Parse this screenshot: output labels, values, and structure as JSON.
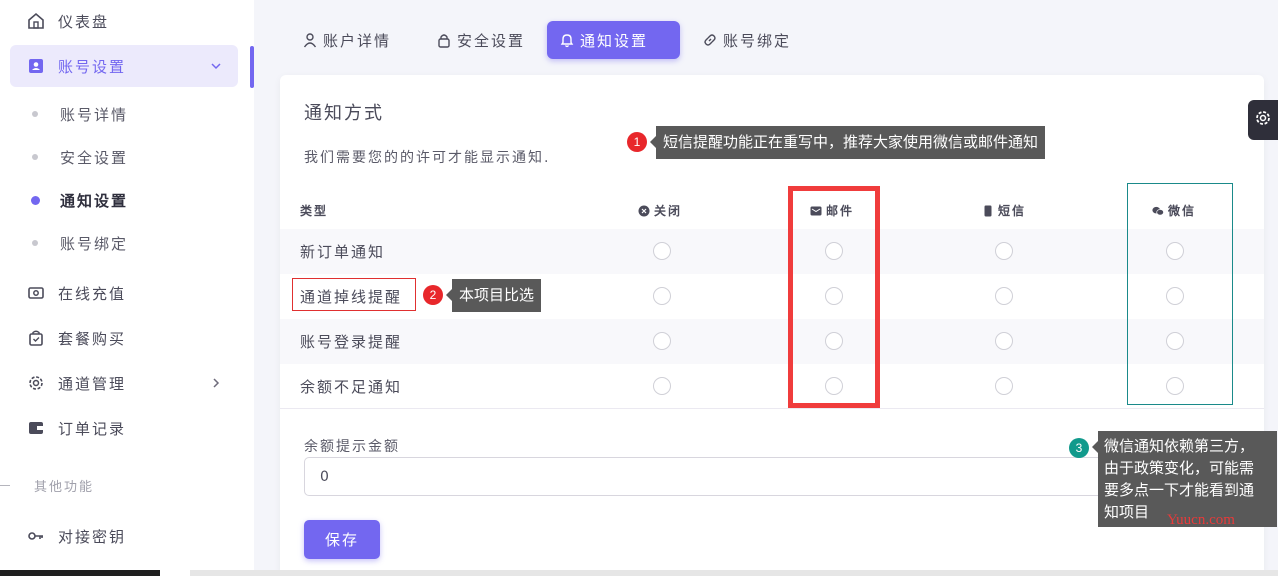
{
  "sidebar": {
    "dashboard": "仪表盘",
    "account_settings": "账号设置",
    "sub_items": [
      "账号详情",
      "安全设置",
      "通知设置",
      "账号绑定"
    ],
    "recharge": "在线充值",
    "package": "套餐购买",
    "channel": "通道管理",
    "orders": "订单记录",
    "section_other": "其他功能",
    "api_key": "对接密钥"
  },
  "tabs": [
    {
      "label": "账户详情",
      "icon": "user-icon"
    },
    {
      "label": "安全设置",
      "icon": "lock-icon"
    },
    {
      "label": "通知设置",
      "icon": "bell-icon"
    },
    {
      "label": "账号绑定",
      "icon": "link-icon"
    }
  ],
  "card": {
    "title": "通知方式",
    "description": "我们需要您的的许可才能显示通知.",
    "columns": [
      "类型",
      "关闭",
      "邮件",
      "短信",
      "微信"
    ],
    "rows": [
      "新订单通知",
      "通道掉线提醒",
      "账号登录提醒",
      "余额不足通知"
    ],
    "amount_label": "余额提示金额",
    "amount_value": "0",
    "save_label": "保存"
  },
  "annotations": {
    "badge1": "1",
    "tip1": "短信提醒功能正在重写中，推荐大家使用微信或邮件通知",
    "badge2": "2",
    "tip2": "本项目比选",
    "badge3": "3",
    "tip3_lines": [
      "微信通知依赖第三方，",
      "由于政策变化，可能需",
      "要多点一下才能看到通",
      "知项目"
    ],
    "watermark": "Yuucn.com"
  },
  "colors": {
    "accent": "#7367f0",
    "annotation_red": "#f03c3c",
    "annotation_teal": "#119a8c",
    "tooltip_bg": "#595959"
  }
}
